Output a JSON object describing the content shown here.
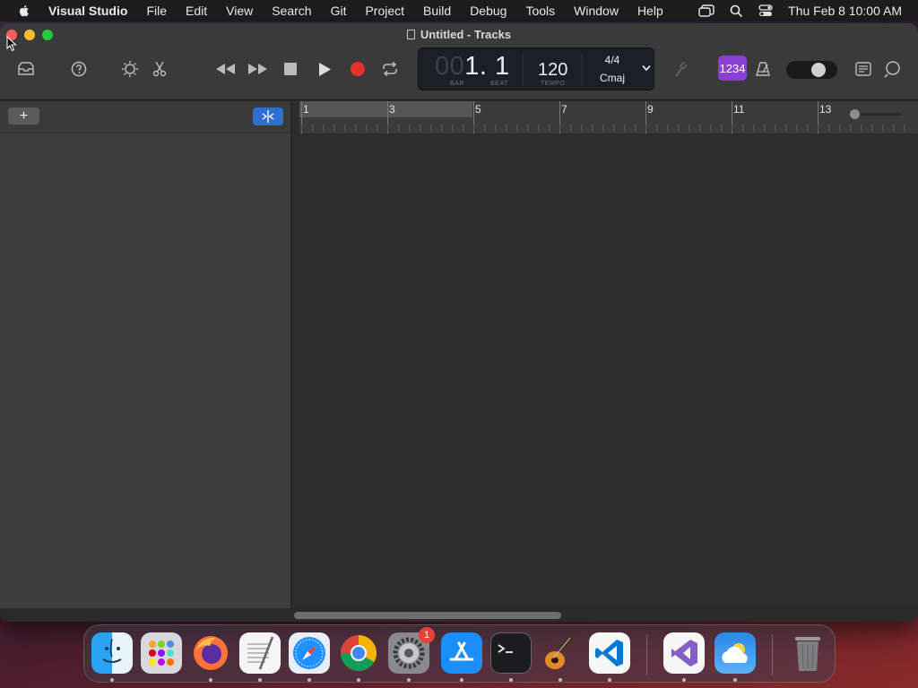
{
  "menubar": {
    "app_name": "Visual Studio",
    "items": [
      "File",
      "Edit",
      "View",
      "Search",
      "Git",
      "Project",
      "Build",
      "Debug",
      "Tools",
      "Window",
      "Help"
    ],
    "clock": "Thu Feb 8  10:00 AM"
  },
  "window": {
    "title": "Untitled - Tracks"
  },
  "lcd": {
    "bar_dim": "00",
    "position": "1. 1",
    "bar_label": "BAR",
    "beat_label": "BEAT",
    "tempo": "120",
    "tempo_label": "TEMPO",
    "time_signature": "4/4",
    "key": "Cmaj"
  },
  "count_in": "1234",
  "left_panel": {
    "add_label": "+"
  },
  "ruler": {
    "bars": [
      "1",
      "3",
      "5",
      "7",
      "9",
      "11",
      "13"
    ]
  },
  "dock": {
    "apps": [
      {
        "name": "Finder",
        "icon": "finder-icon"
      },
      {
        "name": "Launchpad",
        "icon": "launchpad-icon"
      },
      {
        "name": "Firefox",
        "icon": "firefox-icon"
      },
      {
        "name": "TextEdit",
        "icon": "textedit-icon"
      },
      {
        "name": "Safari",
        "icon": "safari-icon"
      },
      {
        "name": "Chrome",
        "icon": "chrome-icon"
      },
      {
        "name": "System Settings",
        "icon": "settings-icon",
        "badge": "1"
      },
      {
        "name": "App Store",
        "icon": "appstore-icon"
      },
      {
        "name": "Terminal",
        "icon": "terminal-icon"
      },
      {
        "name": "GarageBand",
        "icon": "garageband-icon"
      },
      {
        "name": "VS Code",
        "icon": "vscode-icon"
      },
      {
        "name": "Visual Studio",
        "icon": "visualstudio-icon"
      },
      {
        "name": "Weather",
        "icon": "weather-icon"
      },
      {
        "name": "Trash",
        "icon": "trash-icon"
      }
    ],
    "settings_badge": "1"
  },
  "colors": {
    "accent_blue": "#2f6fd1",
    "count_in_purple": "#8b3fd6",
    "record_red": "#e3312b"
  }
}
